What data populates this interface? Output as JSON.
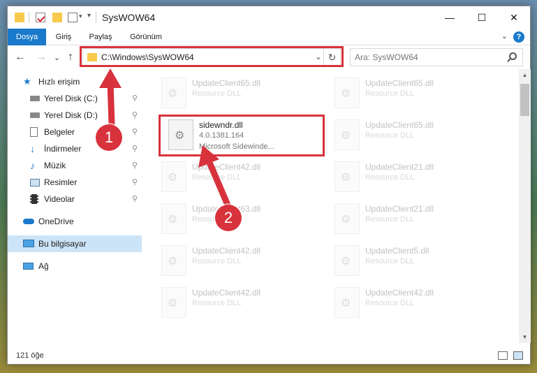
{
  "window": {
    "title": "SysWOW64",
    "buttons": {
      "minimize": "—",
      "maximize": "☐",
      "close": "✕"
    }
  },
  "ribbon": {
    "tabs": [
      "Dosya",
      "Giriş",
      "Paylaş",
      "Görünüm"
    ],
    "help": "?",
    "collapse": "⌄"
  },
  "nav": {
    "back": "←",
    "forward": "→",
    "recent": "⌄",
    "up": "↑",
    "address": "C:\\Windows\\SysWOW64",
    "address_dropdown": "⌄",
    "refresh": "↻",
    "search_placeholder": "Ara: SysWOW64"
  },
  "sidebar": {
    "items": [
      {
        "label": "Hızlı erişim",
        "icon": "star-icon",
        "pinned": false
      },
      {
        "label": "Yerel Disk (C:)",
        "icon": "drive-icon",
        "pinned": true
      },
      {
        "label": "Yerel Disk (D:)",
        "icon": "drive-icon",
        "pinned": true
      },
      {
        "label": "Belgeler",
        "icon": "documents-icon",
        "pinned": true
      },
      {
        "label": "İndirmeler",
        "icon": "downloads-icon",
        "pinned": true
      },
      {
        "label": "Müzik",
        "icon": "music-icon",
        "pinned": true
      },
      {
        "label": "Resimler",
        "icon": "pictures-icon",
        "pinned": true
      },
      {
        "label": "Videolar",
        "icon": "videos-icon",
        "pinned": true
      },
      {
        "label": "OneDrive",
        "icon": "cloud-icon",
        "pinned": false
      },
      {
        "label": "Bu bilgisayar",
        "icon": "computer-icon",
        "pinned": false,
        "selected": true
      },
      {
        "label": "Ağ",
        "icon": "network-icon",
        "pinned": false
      }
    ],
    "pin_glyph": "📌"
  },
  "files": [
    {
      "name": "UpdateClient65.dll",
      "type": "Resource DLL",
      "faded": true
    },
    {
      "name": "UpdateClient65.dll",
      "type": "Resource DLL",
      "faded": true
    },
    {
      "name": "sidewndr.dll",
      "type": "4.0.1381.164",
      "desc": "Microsoft Sidewinde...",
      "faded": false
    },
    {
      "name": "UpdateClient65.dll",
      "type": "Resource DLL",
      "faded": true
    },
    {
      "name": "UpdateClient42.dll",
      "type": "Resource DLL",
      "faded": true
    },
    {
      "name": "UpdateClient21.dll",
      "type": "Resource DLL",
      "faded": true
    },
    {
      "name": "UpdateClient63.dll",
      "type": "Resource DLL",
      "faded": true
    },
    {
      "name": "UpdateClient21.dll",
      "type": "Resource DLL",
      "faded": true
    },
    {
      "name": "UpdateClient42.dll",
      "type": "Resource DLL",
      "faded": true
    },
    {
      "name": "UpdateClient5.dll",
      "type": "Resource DLL",
      "faded": true
    },
    {
      "name": "UpdateClient42.dll",
      "type": "Resource DLL",
      "faded": true
    },
    {
      "name": "UpdateClient42.dll",
      "type": "Resource DLL",
      "faded": true
    }
  ],
  "status": {
    "item_count": "121 öğe"
  },
  "annotations": {
    "step1": "1",
    "step2": "2",
    "color": "#d8323c"
  }
}
